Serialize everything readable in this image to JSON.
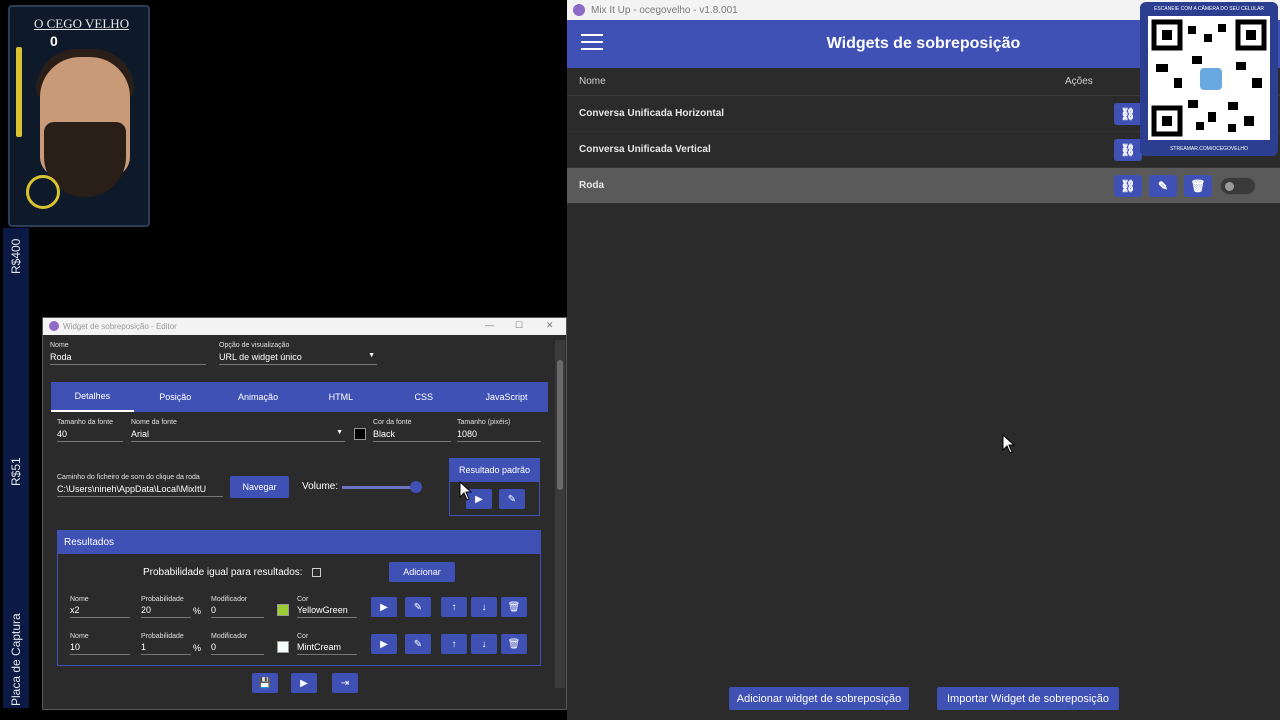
{
  "overlay": {
    "streamer_name": "O CEGO VELHO",
    "counter": "0",
    "side_labels": [
      "R$400",
      "R$51",
      "Placa de Captura"
    ]
  },
  "main_window": {
    "title": "Mix It Up - ocegovelho - v1.8.001",
    "app_title": "Widgets de sobreposição",
    "columns": {
      "name": "Nome",
      "actions": "Ações"
    },
    "rows": [
      {
        "name": "Conversa Unificada Horizontal"
      },
      {
        "name": "Conversa Unificada Vertical"
      },
      {
        "name": "Roda"
      }
    ],
    "add_button": "Adicionar widget de sobreposição",
    "import_button": "Importar Widget de sobreposição",
    "qr": {
      "top_text": "ESCANEIE COM A CÂMERA DO SEU CELULAR",
      "bottom_text": "STREAMAR.COM/OCEGOVELHO"
    }
  },
  "editor": {
    "title": "Widget de sobreposição - Editor",
    "name_label": "Nome",
    "name_value": "Roda",
    "view_label": "Opção de visualização",
    "view_value": "URL de widget único",
    "tabs": [
      "Detalhes",
      "Posição",
      "Animação",
      "HTML",
      "CSS",
      "JavaScript"
    ],
    "font_size_label": "Tamanho da fonte",
    "font_size": "40",
    "font_name_label": "Nome da fonte",
    "font_name": "Arial",
    "font_color_label": "Cor da fonte",
    "font_color": "Black",
    "size_label": "Tamanho (pixéis)",
    "size": "1080",
    "sound_label": "Caminho do ficheiro de som do clique da roda",
    "sound_path": "C:\\Users\\nineh\\AppData\\Local\\MixItU",
    "browse": "Navegar",
    "volume_label": "Volume:",
    "volume": 0.95,
    "default_result": "Resultado padrão",
    "results_header": "Resultados",
    "equal_prob_label": "Probabilidade igual para resultados:",
    "add": "Adicionar",
    "result_labels": {
      "name": "Nome",
      "prob": "Probabilidade",
      "mod": "Modificador",
      "color": "Cor",
      "percent": "%"
    },
    "results": [
      {
        "name": "x2",
        "prob": "20",
        "mod": "0",
        "color": "YellowGreen",
        "swatch": "#9acd32"
      },
      {
        "name": "10",
        "prob": "1",
        "mod": "0",
        "color": "MintCream",
        "swatch": "#f5fffa"
      }
    ],
    "colors": {
      "accent": "#3f51b5",
      "bg": "#2b2b2b"
    }
  }
}
